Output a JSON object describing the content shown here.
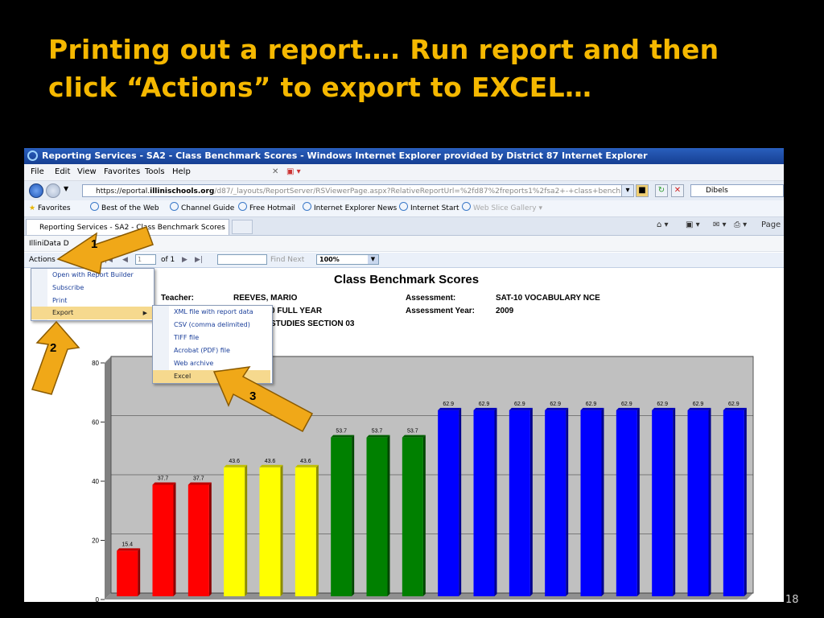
{
  "slide": {
    "title_line1": "Printing out a report…. Run report and then",
    "title_line2": "click “Actions” to export to EXCEL…",
    "page_number": "18",
    "title_color": "#f5b800"
  },
  "browser": {
    "window_title": "Reporting Services - SA2 - Class Benchmark Scores - Windows Internet Explorer provided by District 87 Internet Explorer",
    "menu": [
      "File",
      "Edit",
      "View",
      "Favorites",
      "Tools",
      "Help"
    ],
    "address_prefix": "https://eportal.",
    "address_domain": "illinischools.org",
    "address_rest": "/d87/_layouts/ReportServer/RSViewerPage.aspx?RelativeReportUrl=%2fd87%2freports1%2fsa2+-+class+benchmark+scores",
    "search_text": "Dibels",
    "favorites_label": "Favorites",
    "favorites": [
      "Best of the Web",
      "Channel Guide",
      "Free Hotmail",
      "Internet Explorer News",
      "Internet Start"
    ],
    "favorites_dim": "Web Slice Gallery",
    "tab_label": "Reporting Services - SA2 - Class Benchmark Scores",
    "page_menu": "Page"
  },
  "viewer": {
    "breadcrumb": "IlliniData D",
    "actions_label": "Actions",
    "page_current": "1",
    "page_of": "of 1",
    "find_next": "Find Next",
    "zoom": "100%"
  },
  "actions_menu": [
    "Open with Report Builder",
    "Subscribe",
    "Print",
    "Export"
  ],
  "export_menu": [
    "XML file with report data",
    "CSV (comma delimited)",
    "TIFF file",
    "Acrobat (PDF) file",
    "Web archive",
    "Excel"
  ],
  "report": {
    "title": "Class Benchmark Scores",
    "teacher_label": "Teacher:",
    "teacher_value": "REEVES, MARIO",
    "year_partial": "0 FULL YEAR",
    "section_partial": "STUDIES SECTION 03",
    "assessment_label": "Assessment:",
    "assessment_value": "SAT-10 VOCABULARY NCE",
    "assessment_year_label": "Assessment Year:",
    "assessment_year_value": "2009"
  },
  "callouts": [
    "1",
    "2",
    "3"
  ],
  "chart_data": {
    "type": "bar",
    "values": [
      15.4,
      37.7,
      37.7,
      43.6,
      43.6,
      43.6,
      53.7,
      53.7,
      53.7,
      62.9,
      62.9,
      62.9,
      62.9,
      62.9,
      62.9,
      62.9,
      62.9,
      62.9
    ],
    "colors": [
      "#ff0000",
      "#ff0000",
      "#ff0000",
      "#ffff00",
      "#ffff00",
      "#ffff00",
      "#008000",
      "#008000",
      "#008000",
      "#0000ff",
      "#0000ff",
      "#0000ff",
      "#0000ff",
      "#0000ff",
      "#0000ff",
      "#0000ff",
      "#0000ff",
      "#0000ff"
    ],
    "yticks": [
      0,
      20,
      40,
      60,
      80
    ],
    "ylim": [
      0,
      80
    ],
    "grid": true
  }
}
